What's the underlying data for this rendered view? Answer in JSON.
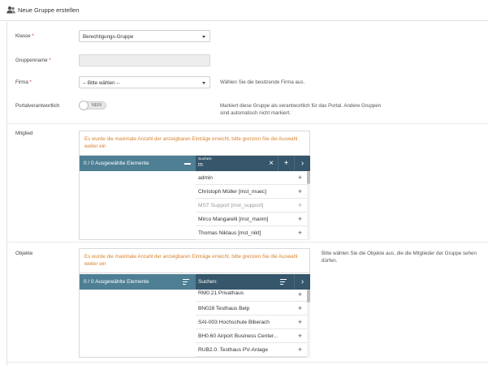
{
  "header": {
    "title": "Neue Gruppe erstellen",
    "icon": "users-icon"
  },
  "form": {
    "klasse": {
      "label": "Klasse",
      "required": "*",
      "value": "Berechtigungs-Gruppe"
    },
    "gruppenname": {
      "label": "Gruppenname",
      "required": "*",
      "value": ""
    },
    "firma": {
      "label": "Firma",
      "required": "*",
      "value": "-- Bitte wählen --",
      "hint": "Wählen Sie die besitzende Firma aus."
    },
    "portal": {
      "label": "Portalverantwortlich",
      "toggle_value": "NEIN",
      "hint": "Markiert diese Gruppe als verantwortlich für das Portal. Andere Gruppen sind automatisch nicht markiert."
    }
  },
  "mitglied": {
    "label": "Mitglied",
    "warning": "Es wurde die maximale Anzahl der anzeigbaren Einträge erreicht, bitte grenzen Sie die Auswahl weiter ein",
    "selected_header": "0 / 0 Ausgewählte Elemente",
    "search_label": "Suchen:",
    "search_value": "m",
    "items": [
      {
        "text": "admin",
        "disabled": false
      },
      {
        "text": "Christoph Müller [mst_muec]",
        "disabled": false
      },
      {
        "text": "MST Support [mst_support]",
        "disabled": true
      },
      {
        "text": "Mirco Mangarelli [mst_manm]",
        "disabled": false
      },
      {
        "text": "Thomas Niklaus [mst_nikt]",
        "disabled": false
      }
    ]
  },
  "objekte": {
    "label": "Objekte",
    "warning": "Es wurde die maximale Anzahl der anzeigbaren Einträge erreicht, bitte grenzen Sie die Auswahl weiter ein",
    "hint": "Bitte wählen Sie die Objekte aus, die die Mitglieder der Gruppe sehen dürfen.",
    "selected_header": "0 / 0 Ausgewählte Elemente",
    "search_label": "Suchen:",
    "items": [
      {
        "text": "RM0.21 Privathaus"
      },
      {
        "text": "BN028 Testhaus Belp"
      },
      {
        "text": "SAI-003 Hochschule Biberach"
      },
      {
        "text": "BH0.60 Airport Business Center..."
      },
      {
        "text": "RUB2.0. Testhaus PV-Anlage"
      }
    ]
  },
  "colors": {
    "bar_light": "#4e7f94",
    "bar_dark": "#35566b",
    "warning": "#d9822b",
    "required": "#d0393a"
  }
}
